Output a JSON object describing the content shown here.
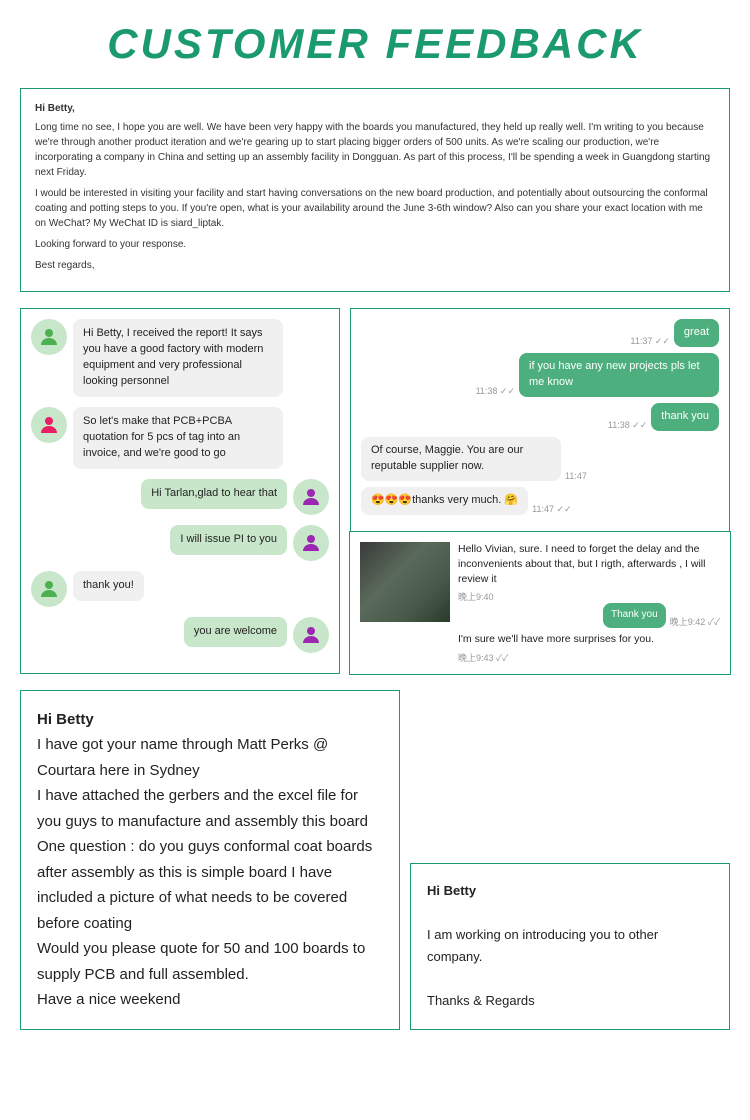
{
  "page": {
    "title": "CUSTOMER FEEDBACK"
  },
  "email1": {
    "greeting": "Hi Betty,",
    "para1": "Long time no see, I hope you are well. We have been very happy with the boards you manufactured, they held up really well. I'm writing to you because we're through another product iteration and we're gearing up to start placing bigger orders of 500 units. As we're scaling our production, we're incorporating a company in China and setting up an assembly facility in Dongguan. As part of this process, I'll be spending a week in Guangdong starting next Friday.",
    "para2": "I would be interested in visiting your facility and start having conversations on the new board production, and potentially about outsourcing the conformal coating and potting steps to you. If you're open, what is your availability around the June 3-6th window? Also can you share your exact location with me on WeChat? My WeChat ID is siard_liptak.",
    "para3": "Looking forward to your response.",
    "closing": "Best regards,"
  },
  "chat_left": {
    "messages": [
      {
        "sender": "other",
        "text": "Hi Betty, I received the report! It says you have a good factory with modern equipment and very professional looking personnel"
      },
      {
        "sender": "other",
        "text": "So let's make that PCB+PCBA quotation for 5 pcs of tag into an invoice, and we're good to go"
      },
      {
        "sender": "self",
        "text": "Hi Tarlan,glad to hear that"
      },
      {
        "sender": "self",
        "text": "I will issue PI to you"
      },
      {
        "sender": "other",
        "text": "thank you!"
      },
      {
        "sender": "self",
        "text": "you are welcome"
      }
    ]
  },
  "chat_right": {
    "messages": [
      {
        "sender": "self",
        "text": "great",
        "time": "11:37"
      },
      {
        "sender": "self",
        "text": "if you have any new projects pls let me know",
        "time": "11:38"
      },
      {
        "sender": "self",
        "text": "thank you",
        "time": "11:38"
      },
      {
        "sender": "other",
        "text": "Of course, Maggie. You are our reputable supplier now.",
        "time": "11:47"
      },
      {
        "sender": "other",
        "text": "😍😍😍thanks very much. 🤗",
        "time": "11:47"
      }
    ],
    "overlay": {
      "received_text": "Hello Vivian, sure. I need to forget the delay and the inconvenients about that, but I rigth, afterwards , I will review it",
      "received_time": "晚上9:40",
      "sent_text": "Thank you",
      "sent_time": "晚上9:42",
      "sent_text2": "I'm sure we'll have more surprises for you.",
      "sent_time2": "晚上9:43"
    }
  },
  "email2": {
    "lines": [
      "Hi Betty",
      "I have got your name through Matt Perks @ Courtara here in Sydney",
      "I have attached the gerbers and the excel file for you guys to manufacture and assembly this board",
      "One question : do you guys conformal coat boards after assembly as this is simple board I have included a picture of what needs to be covered before coating",
      "Would you please quote for 50 and 100 boards to supply PCB and full assembled.",
      "Have a nice weekend"
    ]
  },
  "email3": {
    "greeting": "Hi Betty",
    "para1": "I am working on introducing you to other company.",
    "closing": "Thanks & Regards"
  }
}
